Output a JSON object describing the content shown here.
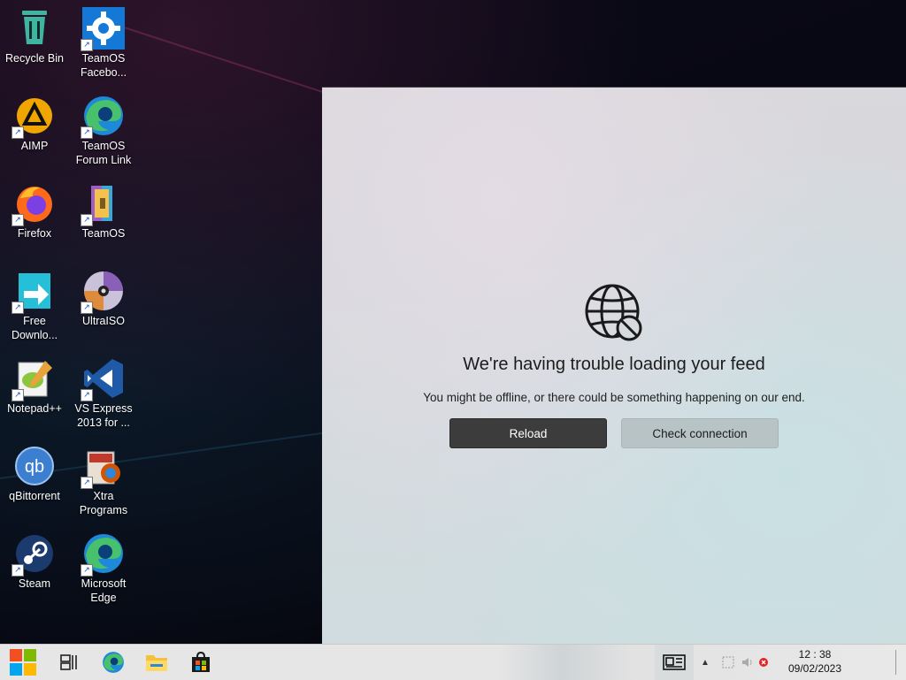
{
  "desktop": {
    "icons": [
      {
        "label": "Recycle Bin",
        "icon": "recycle-bin-icon"
      },
      {
        "label": "TeamOS Facebo...",
        "icon": "gear-icon"
      },
      {
        "label": "AIMP",
        "icon": "aimp-icon"
      },
      {
        "label": "TeamOS Forum Link",
        "icon": "edge-icon"
      },
      {
        "label": "Firefox",
        "icon": "firefox-icon"
      },
      {
        "label": "TeamOS",
        "icon": "winrar-icon"
      },
      {
        "label": "Free Downlo...",
        "icon": "download-manager-icon"
      },
      {
        "label": "UltraISO",
        "icon": "disc-icon"
      },
      {
        "label": "Notepad++",
        "icon": "notepad-plus-plus-icon"
      },
      {
        "label": "VS Express 2013 for ...",
        "icon": "visual-studio-icon"
      },
      {
        "label": "qBittorrent",
        "icon": "qbittorrent-icon"
      },
      {
        "label": "Xtra Programs",
        "icon": "xtra-programs-icon"
      },
      {
        "label": "Steam",
        "icon": "steam-icon"
      },
      {
        "label": "Microsoft Edge",
        "icon": "edge-icon"
      }
    ]
  },
  "widgets_panel": {
    "title": "We're having trouble loading your feed",
    "subtitle": "You might be offline, or there could be something happening on our end.",
    "reload_label": "Reload",
    "check_connection_label": "Check connection",
    "icon": "globe-blocked-icon"
  },
  "taskbar": {
    "items": [
      "start-icon",
      "task-view-icon",
      "edge-icon",
      "file-explorer-icon",
      "store-icon"
    ],
    "clock_time": "12 : 38",
    "clock_date": "09/02/2023"
  },
  "colors": {
    "primary_button": "#3c3c3c",
    "secondary_button": "#b8c3c5",
    "taskbar": "#e6e6e6"
  }
}
